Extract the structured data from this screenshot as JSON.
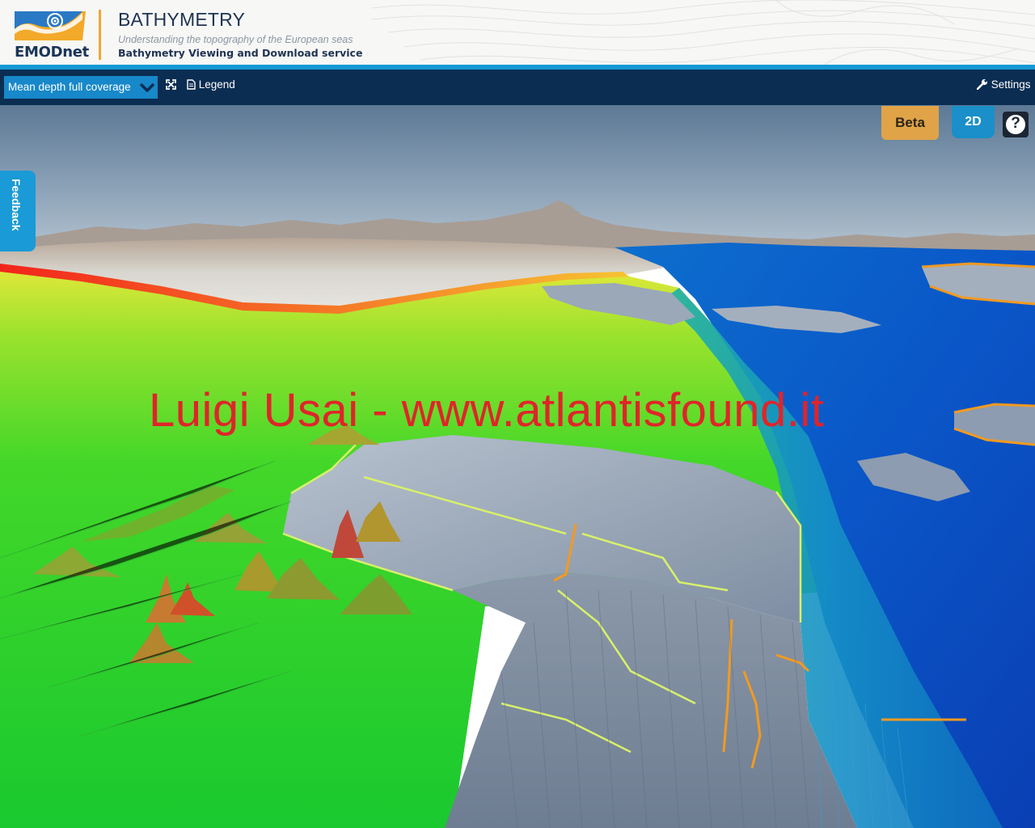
{
  "header": {
    "logo_text": "EMODnet",
    "title": "BATHYMETRY",
    "subtitle": "Understanding the topography of the European seas",
    "service": "Bathymetry Viewing and Download service"
  },
  "toolbar": {
    "layer_select": "Mean depth full coverage",
    "legend_label": "Legend",
    "settings_label": "Settings"
  },
  "map": {
    "beta_label": "Beta",
    "mode_label": "2D",
    "help_label": "?",
    "feedback_label": "Feedback",
    "watermark": "Luigi Usai - www.atlantisfound.it"
  },
  "colors": {
    "header_bg": "#f7f7f6",
    "accent_blue": "#1598d4",
    "toolbar_bg": "#0b2d52",
    "select_bg": "#1788c9",
    "beta_bg": "#e0a348",
    "brand_orange": "#f0a530",
    "watermark_red": "#e0242a"
  }
}
